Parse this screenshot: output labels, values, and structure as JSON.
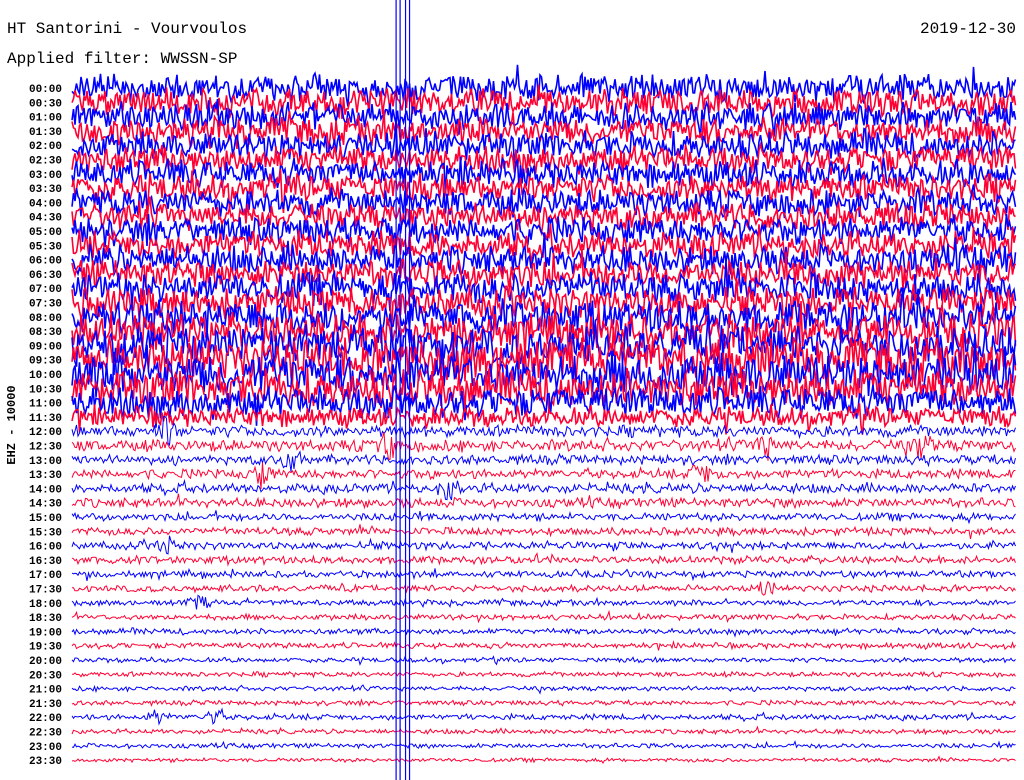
{
  "header": {
    "title": "HT Santorini - Vourvoulos",
    "filter": "Applied filter: WWSSN-SP",
    "date": "2019-12-30"
  },
  "chart_data": {
    "type": "line",
    "title": "HT Santorini - Vourvoulos",
    "subtitle": "Applied filter: WWSSN-SP",
    "ylabel": "EHZ - 10000",
    "row_minutes": 30,
    "colors": {
      "even_rows": "#0000ff",
      "odd_rows": "#ff0033",
      "marker": "#0000ff"
    },
    "rows": [
      "00:00",
      "00:30",
      "01:00",
      "01:30",
      "02:00",
      "02:30",
      "03:00",
      "03:30",
      "04:00",
      "04:30",
      "05:00",
      "05:30",
      "06:00",
      "06:30",
      "07:00",
      "07:30",
      "08:00",
      "08:30",
      "09:00",
      "09:30",
      "10:00",
      "10:30",
      "11:00",
      "11:30",
      "12:00",
      "12:30",
      "13:00",
      "13:30",
      "14:00",
      "14:30",
      "15:00",
      "15:30",
      "16:00",
      "16:30",
      "17:00",
      "17:30",
      "18:00",
      "18:30",
      "19:00",
      "19:30",
      "20:00",
      "20:30",
      "21:00",
      "21:30",
      "22:00",
      "22:30",
      "23:00",
      "23:30"
    ],
    "relative_amplitude": [
      14,
      14,
      14,
      14,
      14,
      14,
      14,
      14,
      14,
      14,
      14,
      14,
      15,
      15,
      16,
      16,
      18,
      18,
      20,
      22,
      22,
      20,
      16,
      10,
      6,
      6,
      5,
      5,
      5,
      5,
      4,
      4,
      4,
      4,
      3.5,
      3.5,
      3,
      3,
      3,
      3,
      2.5,
      2.5,
      2.5,
      2.5,
      3,
      2.5,
      2.5,
      2
    ],
    "events": [
      {
        "row": 24,
        "minute": 3
      },
      {
        "row": 25,
        "minute": 10
      },
      {
        "row": 25,
        "minute": 22
      },
      {
        "row": 25,
        "minute": 27
      },
      {
        "row": 26,
        "minute": 7
      },
      {
        "row": 27,
        "minute": 6
      },
      {
        "row": 27,
        "minute": 20
      },
      {
        "row": 28,
        "minute": 12
      },
      {
        "row": 32,
        "minute": 3
      },
      {
        "row": 35,
        "minute": 22
      },
      {
        "row": 36,
        "minute": 4
      },
      {
        "row": 44,
        "minute": 2.7
      },
      {
        "row": 44,
        "minute": 4.5
      }
    ],
    "marker_minutes": [
      10.3,
      10.6
    ]
  }
}
